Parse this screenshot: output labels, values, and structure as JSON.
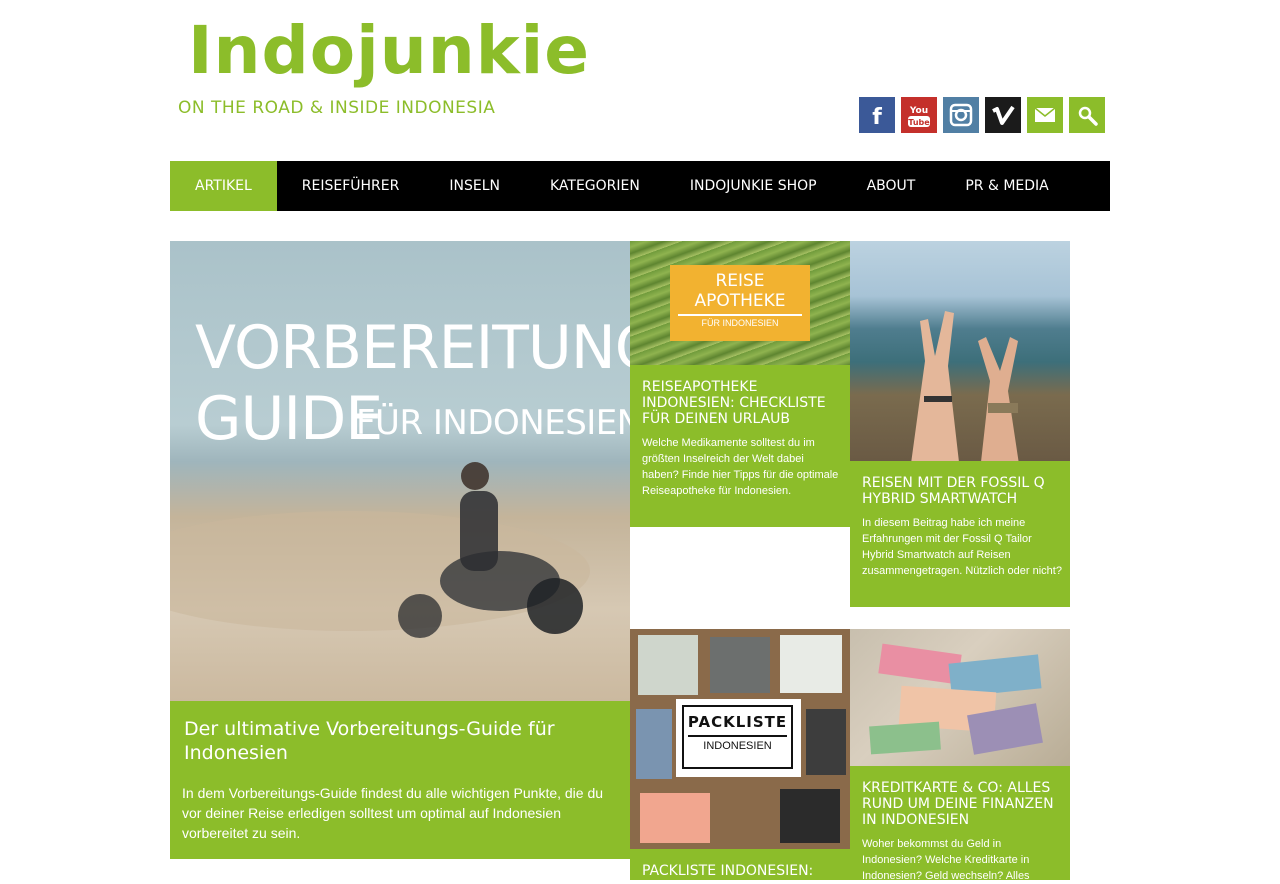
{
  "header": {
    "logo_title": "Indojunkie",
    "logo_subtitle": "ON THE ROAD & INSIDE INDONESIA",
    "brand_color": "#8cbd2a"
  },
  "social": [
    {
      "name": "facebook-icon",
      "color": "#3b5998",
      "glyph": "f"
    },
    {
      "name": "youtube-icon",
      "color": "#c4302b",
      "glyph": "You Tube"
    },
    {
      "name": "instagram-icon",
      "color": "#517fa4",
      "glyph": "instagram"
    },
    {
      "name": "vimeo-icon",
      "color": "#1b1b1b",
      "glyph": "v"
    },
    {
      "name": "mail-icon",
      "color": "#8cbd2a",
      "glyph": "mail"
    },
    {
      "name": "search-icon",
      "color": "#8cbd2a",
      "glyph": "search"
    }
  ],
  "nav": {
    "items": [
      "ARTIKEL",
      "REISEFÜHRER",
      "INSELN",
      "KATEGORIEN",
      "INDOJUNKIE SHOP",
      "ABOUT",
      "PR & MEDIA"
    ],
    "active": "ARTIKEL"
  },
  "featured": {
    "overlay_line1": "VORBEREITUNGS",
    "overlay_line2a": "GUIDE",
    "overlay_line2b": "FÜR INDONESIEN",
    "title": "Der ultimative Vorbereitungs-Guide für Indonesien",
    "desc": "In dem Vorbereitungs-Guide findest du alle wichtigen Punkte, die du vor deiner Reise erledigen solltest um optimal auf Indonesien vorbereitet zu sein."
  },
  "cards": [
    {
      "image_text1": "REISE",
      "image_text2": "APOTHEKE",
      "image_text3": "FÜR INDONESIEN",
      "title": "REISEAPOTHEKE INDONESIEN: CHECKLISTE FÜR DEINEN URLAUB",
      "desc": "Welche Medikamente solltest du im größten Inselreich der Welt dabei haben? Finde hier Tipps für die optimale Reiseapotheke für Indonesien."
    },
    {
      "title": "REISEN MIT DER FOSSIL Q HYBRID SMARTWATCH",
      "desc": "In diesem Beitrag habe ich meine Erfahrungen mit der Fossil Q Tailor Hybrid Smartwatch auf Reisen zusammengetragen. Nützlich oder nicht?"
    },
    {
      "image_text1": "PACKLISTE",
      "image_text2": "INDONESIEN",
      "title": "PACKLISTE INDONESIEN:"
    },
    {
      "title": "KREDITKARTE & CO: ALLES RUND UM DEINE FINANZEN IN INDONESIEN",
      "desc": "Woher bekommst du Geld in Indonesien? Welche Kreditkarte in Indonesien? Geld wechseln? Alles"
    }
  ]
}
